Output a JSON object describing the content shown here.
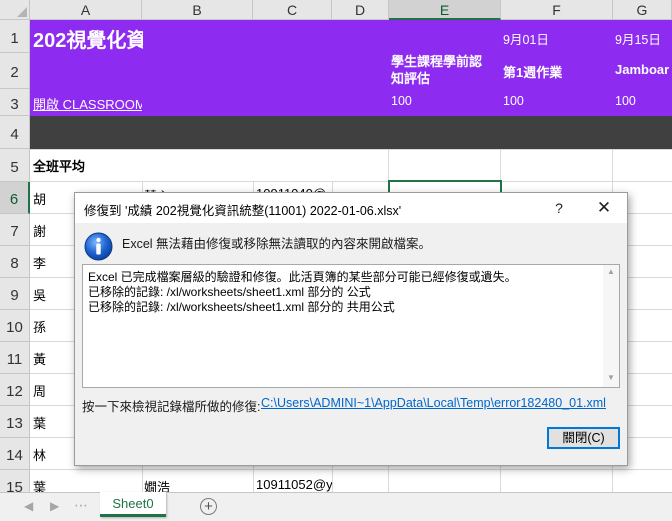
{
  "spreadsheet": {
    "columns": [
      "A",
      "B",
      "C",
      "D",
      "E",
      "F",
      "G"
    ],
    "rows": [
      "1",
      "2",
      "3",
      "4",
      "5",
      "6",
      "7",
      "8",
      "9",
      "10",
      "11",
      "12",
      "13",
      "14",
      "15"
    ],
    "title": "202視覺化資",
    "dates": {
      "f": "9月01日",
      "g": "9月15日"
    },
    "assignments": {
      "e": [
        "學生課程學前認",
        "知評估"
      ],
      "f": "第1週作業",
      "g": "Jamboar"
    },
    "scores": {
      "e": "100",
      "f": "100",
      "g": "100"
    },
    "classroom_link": "開啟 CLASSROOM",
    "class_average": "全班平均",
    "names": [
      "胡",
      "謝",
      "李",
      "吳",
      "孫",
      "黃",
      "周",
      "葉",
      "林",
      "葉"
    ],
    "row6_b": "慧心",
    "row6_c": "10911040@",
    "row15_b": "嫺浩",
    "row15_c": "10911052@y"
  },
  "tabs": {
    "active": "Sheet0",
    "add_label": "+",
    "ellipsis": "⋯",
    "prev": "◀",
    "next": "▶"
  },
  "dialog": {
    "title": "修復到 '成績 202視覺化資訊統整(11001)  2022-01-06.xlsx'",
    "help": "?",
    "close_x": "✕",
    "message": "Excel 無法藉由修復或移除無法讀取的內容來開啟檔案。",
    "details": [
      "Excel 已完成檔案層級的驗證和修復。此活頁簿的某些部分可能已經修復或遺失。",
      "已移除的記錄: /xl/worksheets/sheet1.xml 部分的 公式",
      "已移除的記錄: /xl/worksheets/sheet1.xml 部分的 共用公式"
    ],
    "hint": "按一下來檢視記錄檔所做的修復:",
    "log_path": "C:\\Users\\ADMINI~1\\AppData\\Local\\Temp\\error182480_01.xml",
    "close_button": "關閉(C)"
  },
  "colors": {
    "header_purple": "#8d2bf0",
    "dark_band": "#404040",
    "excel_green": "#217346",
    "link_blue": "#0066cc",
    "focus_blue": "#0078d7"
  }
}
